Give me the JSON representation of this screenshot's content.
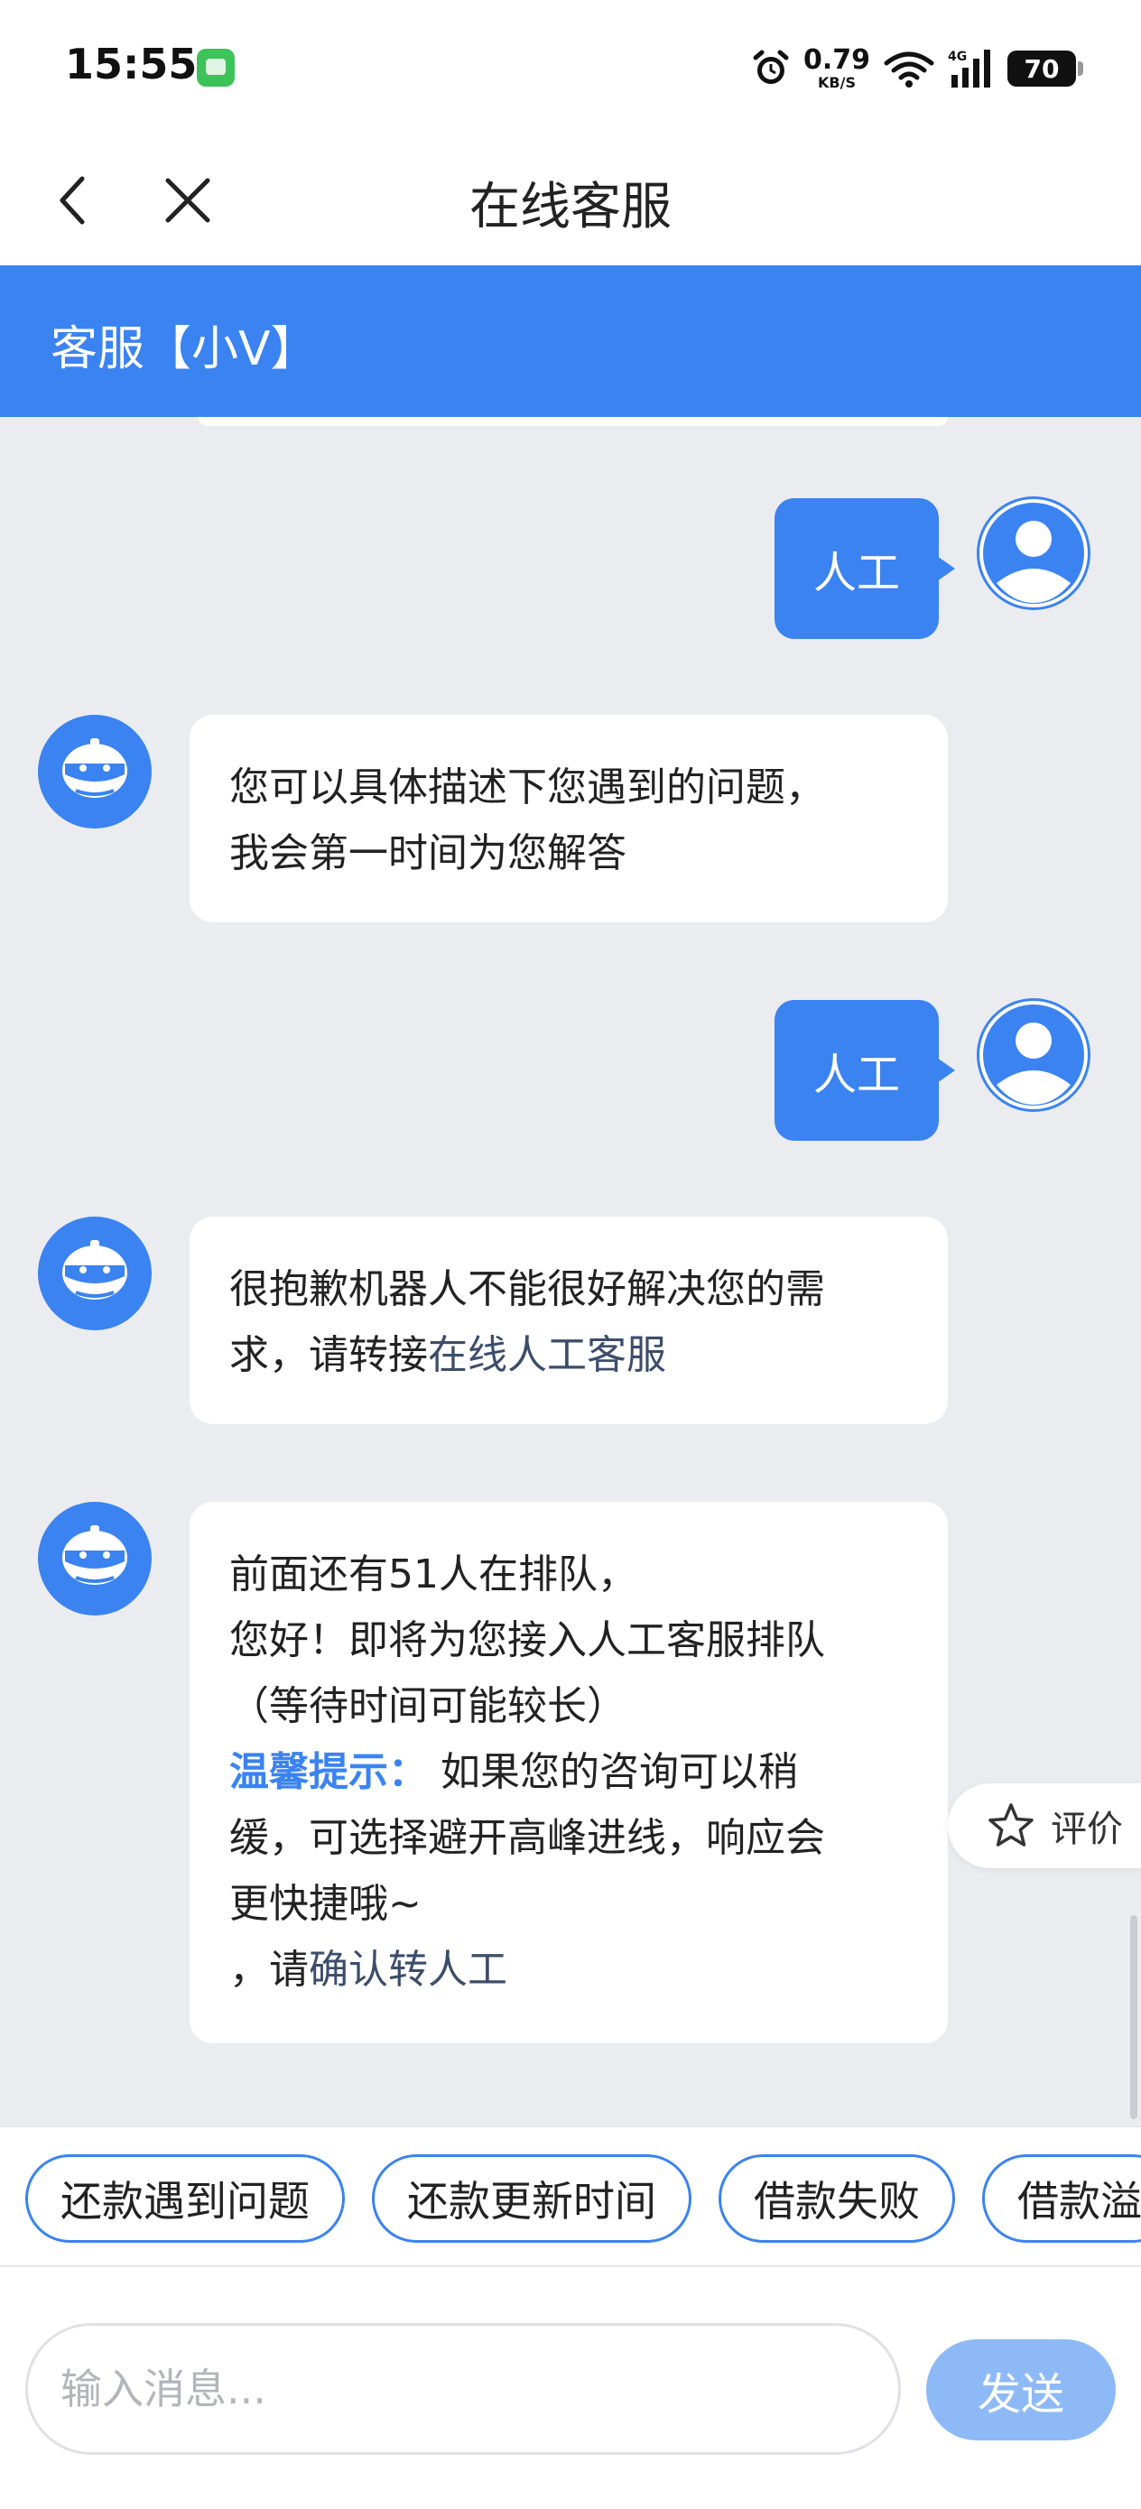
{
  "status_bar": {
    "time": "15:55",
    "net_speed": "0.79",
    "net_unit": "KB/S",
    "battery": "70"
  },
  "title_bar": {
    "title": "在线客服"
  },
  "agent": {
    "name": "客服【小V】"
  },
  "messages": [
    {
      "from": "user",
      "text": "人工"
    },
    {
      "from": "bot",
      "lines": [
        "您可以具体描述下您遇到的问题，",
        "我会第一时间为您解答"
      ]
    },
    {
      "from": "user",
      "text": "人工"
    },
    {
      "from": "bot",
      "line1": "很抱歉机器人不能很好解决您的需",
      "line2_prefix": "求，请转接",
      "line2_link": "在线人工客服"
    },
    {
      "from": "bot",
      "line1": "前面还有51人在排队，",
      "line2": "您好！即将为您接入人工客服排队",
      "line3": "（等待时间可能较长）",
      "tip_label": "温馨提示：",
      "tip_text_1": " 如果您的咨询可以稍",
      "tip_text_2": "缓，可选择避开高峰进线，响应会",
      "tip_text_3": "更快捷哦~",
      "confirm_prefix": "，请",
      "confirm_link": "确认转人工"
    }
  ],
  "rate_button": {
    "label": "评价"
  },
  "quick_replies": [
    "还款遇到问题",
    "还款更新时间",
    "借款失败",
    "借款溢"
  ],
  "input": {
    "placeholder": "输入消息...",
    "value": ""
  },
  "send_button": {
    "label": "发送"
  },
  "colors": {
    "accent": "#3a83f1",
    "chat_bg": "#ebecf0",
    "send_disabled": "#8db9f7",
    "link": "#3c4d6b"
  }
}
